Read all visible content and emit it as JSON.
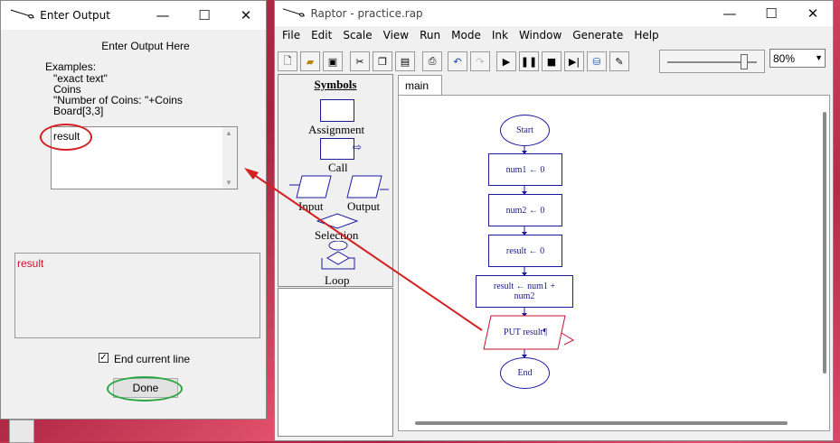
{
  "dialog": {
    "title": "Enter Output",
    "heading": "Enter Output Here",
    "examples_label": "Examples:",
    "examples": [
      "\"exact text\"",
      "Coins",
      "\"Number of Coins: \"+Coins",
      "Board[3,3]"
    ],
    "input_value": "result",
    "preview_text": "result",
    "checkbox_label": "End current line",
    "checkbox_checked": true,
    "done_label": "Done",
    "minimize": "—",
    "maximize": "☐",
    "close": "✕"
  },
  "raptor": {
    "title": "Raptor - practice.rap",
    "menu": [
      "File",
      "Edit",
      "Scale",
      "View",
      "Run",
      "Mode",
      "Ink",
      "Window",
      "Generate",
      "Help"
    ],
    "zoom": "80%",
    "zoom_slider_level": 0.86,
    "symbols_heading": "Symbols",
    "symbols": [
      "Assignment",
      "Call",
      "Input",
      "Output",
      "Selection",
      "Loop"
    ],
    "tab": "main",
    "flowchart": {
      "start": "Start",
      "steps": [
        "num1 ← 0",
        "num2 ← 0",
        "result ← 0",
        "result ← num1 + num2"
      ],
      "output": "PUT result¶",
      "end": "End"
    },
    "minimize": "—",
    "maximize": "☐",
    "close": "✕"
  },
  "colors": {
    "annotation_red": "#d42020",
    "annotation_green": "#2aa640",
    "flow_blue": "#1a1aa0",
    "output_red": "#c8102e"
  }
}
